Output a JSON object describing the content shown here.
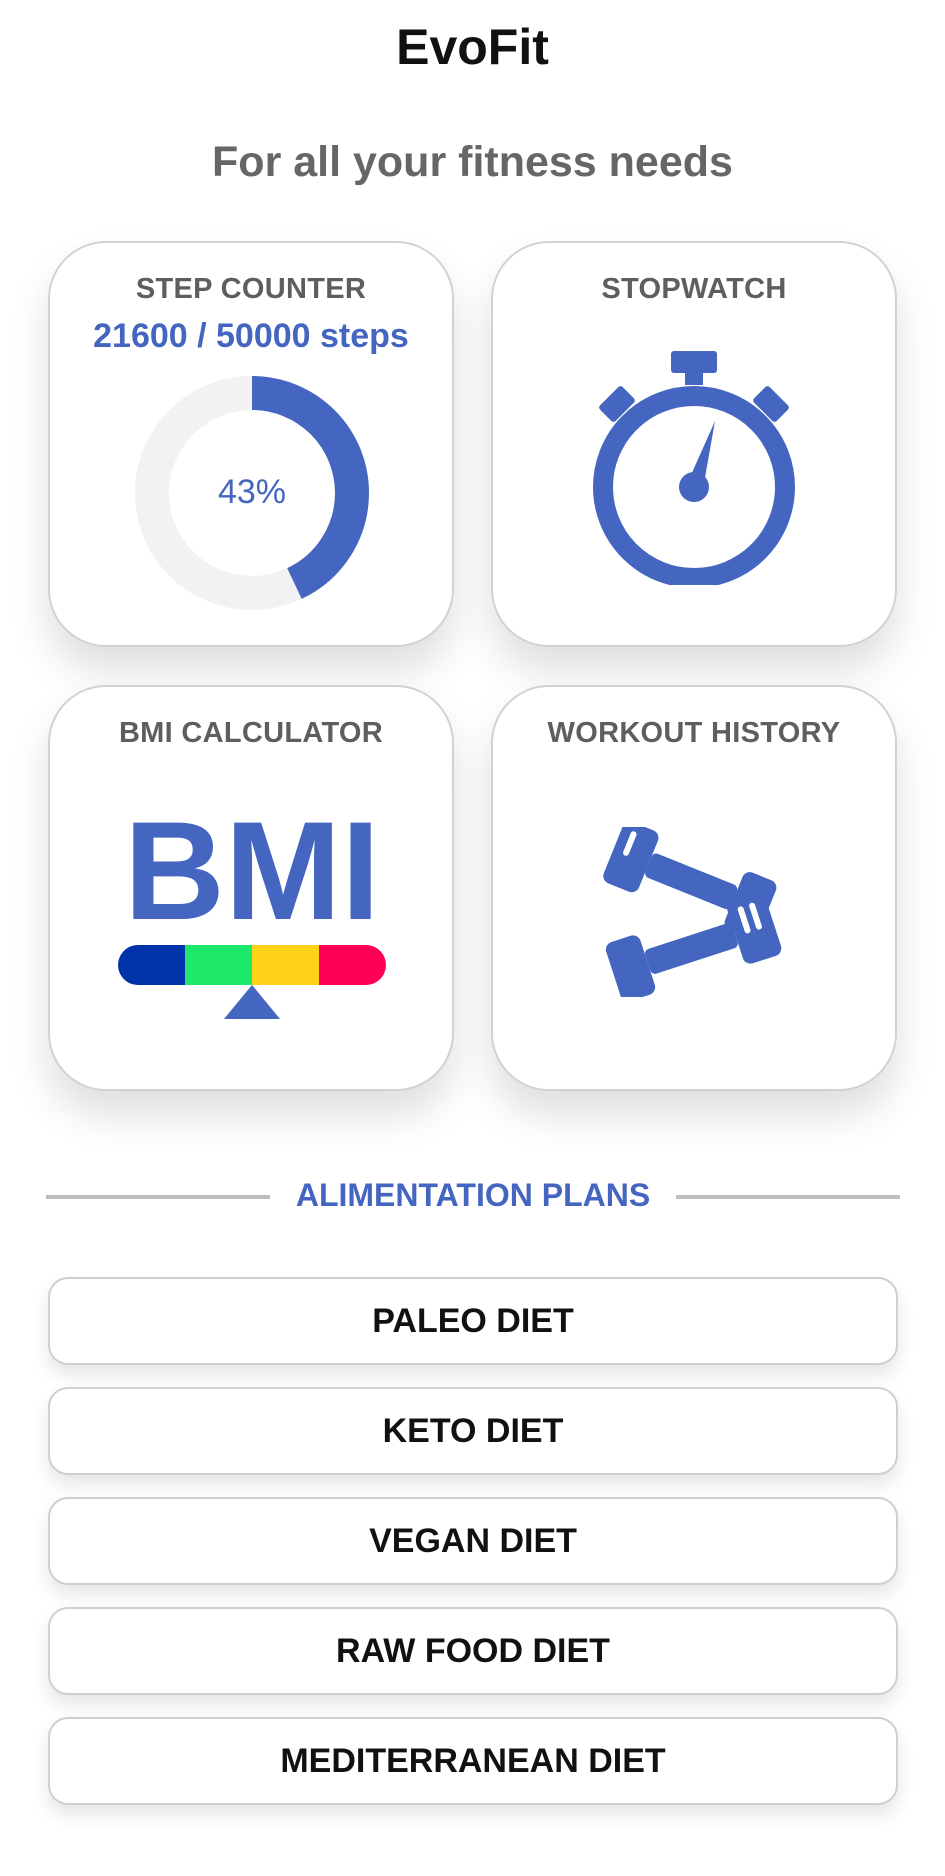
{
  "app": {
    "title": "EvoFit",
    "subtitle": "For all your fitness needs"
  },
  "cards": {
    "step_counter": {
      "title": "STEP COUNTER",
      "steps_label": "21600 / 50000 steps",
      "current_steps": 21600,
      "goal_steps": 50000,
      "progress_percent": 43,
      "percent_label": "43%",
      "icon": "progress-ring-icon"
    },
    "stopwatch": {
      "title": "STOPWATCH",
      "icon": "stopwatch-icon"
    },
    "bmi": {
      "title": "BMI CALCULATOR",
      "logo_text": "BMI",
      "icon": "bmi-scale-icon",
      "scale_colors": [
        "#0033aa",
        "#1ee86a",
        "#ffd21a",
        "#ff0055"
      ]
    },
    "workout": {
      "title": "WORKOUT HISTORY",
      "icon": "dumbbells-icon"
    }
  },
  "section": {
    "title": "ALIMENTATION PLANS"
  },
  "diets": [
    {
      "label": "PALEO DIET"
    },
    {
      "label": "KETO DIET"
    },
    {
      "label": "VEGAN DIET"
    },
    {
      "label": "RAW FOOD DIET"
    },
    {
      "label": "MEDITERRANEAN DIET"
    }
  ],
  "colors": {
    "accent": "#4466c0",
    "card_title": "#5e5e5e",
    "track": "#f2f2f2"
  }
}
